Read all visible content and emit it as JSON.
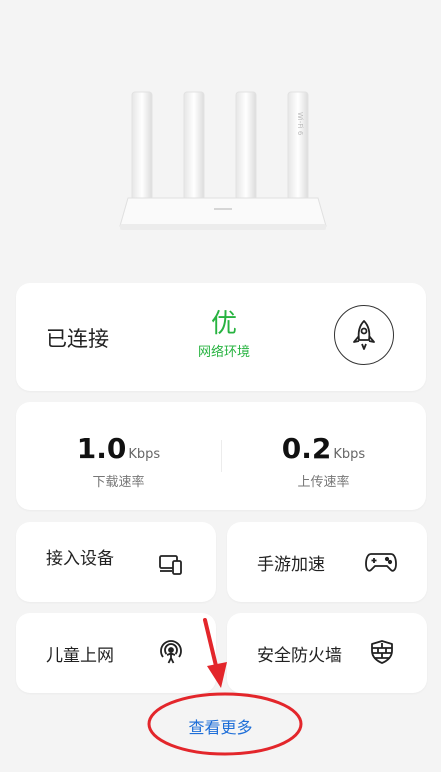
{
  "status": {
    "connected_label": "已连接",
    "quality_grade": "优",
    "quality_label": "网络环境"
  },
  "speed": {
    "download": {
      "value": "1.0",
      "unit": "Kbps",
      "label": "下载速率"
    },
    "upload": {
      "value": "0.2",
      "unit": "Kbps",
      "label": "上传速率"
    }
  },
  "tiles": {
    "devices": {
      "label": "接入设备",
      "icon": "devices-icon"
    },
    "game": {
      "label": "手游加速",
      "icon": "gamepad-icon"
    },
    "kids": {
      "label": "儿童上网",
      "icon": "child-icon"
    },
    "firewall": {
      "label": "安全防火墙",
      "icon": "firewall-icon"
    }
  },
  "more_label": "查看更多",
  "colors": {
    "good": "#27b340",
    "link": "#1f6fd8",
    "annotation": "#e3262b"
  }
}
